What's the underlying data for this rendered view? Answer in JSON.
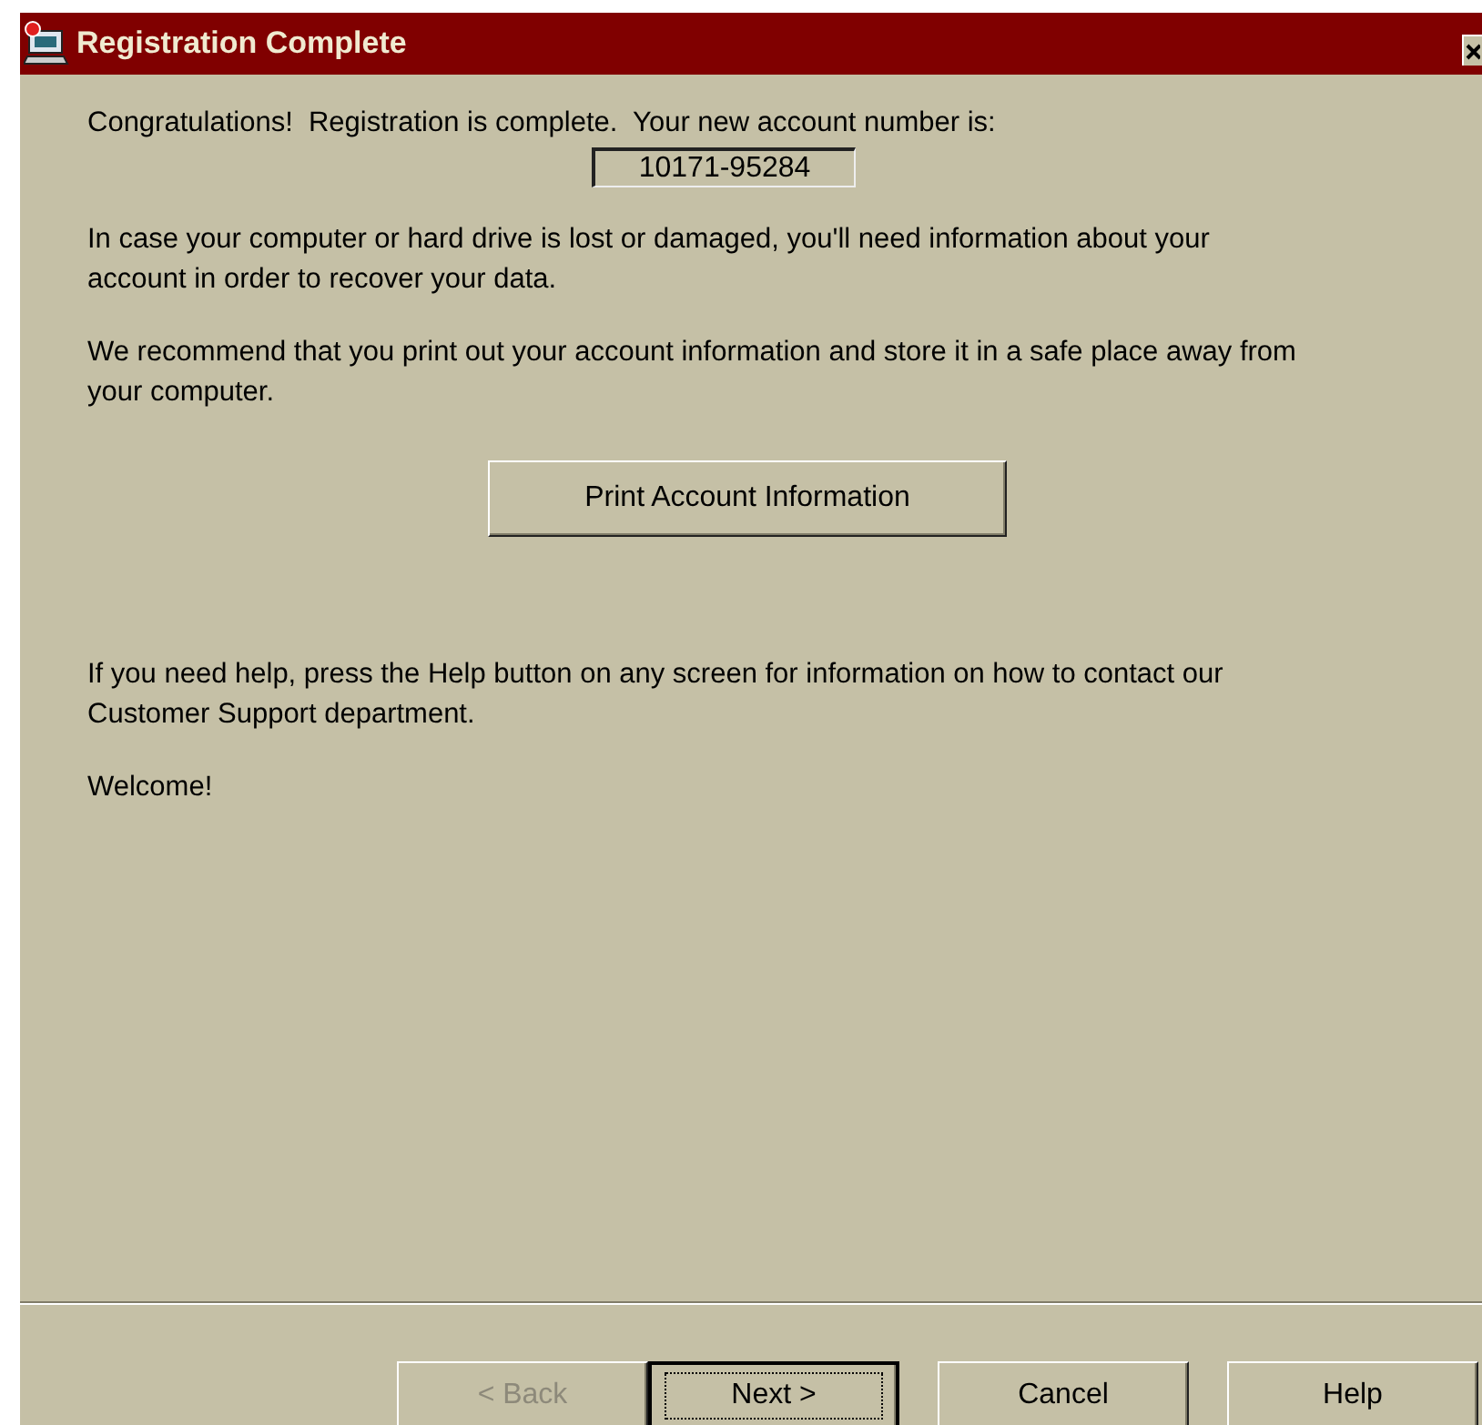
{
  "window": {
    "title": "Registration Complete"
  },
  "intro": "Congratulations!  Registration is complete.  Your new account number is:",
  "account_number": "10171-95284",
  "paragraphs": [
    "In case your computer or hard drive is lost or damaged, you'll need information about your account in order to recover your data.",
    "We recommend that you print out your account information and store it in a safe place away from your computer."
  ],
  "print_button": {
    "label": "Print Account Information"
  },
  "help_text": "If you need help, press the Help button on any screen for information on how to contact our Customer Support department.",
  "welcome": "Welcome!",
  "buttons": [
    {
      "label": "< Back",
      "disabled": true,
      "focused": false
    },
    {
      "label": "Next >",
      "disabled": false,
      "focused": true
    },
    {
      "label": "Cancel",
      "disabled": false,
      "focused": false
    },
    {
      "label": "Help",
      "disabled": false,
      "focused": false
    }
  ]
}
